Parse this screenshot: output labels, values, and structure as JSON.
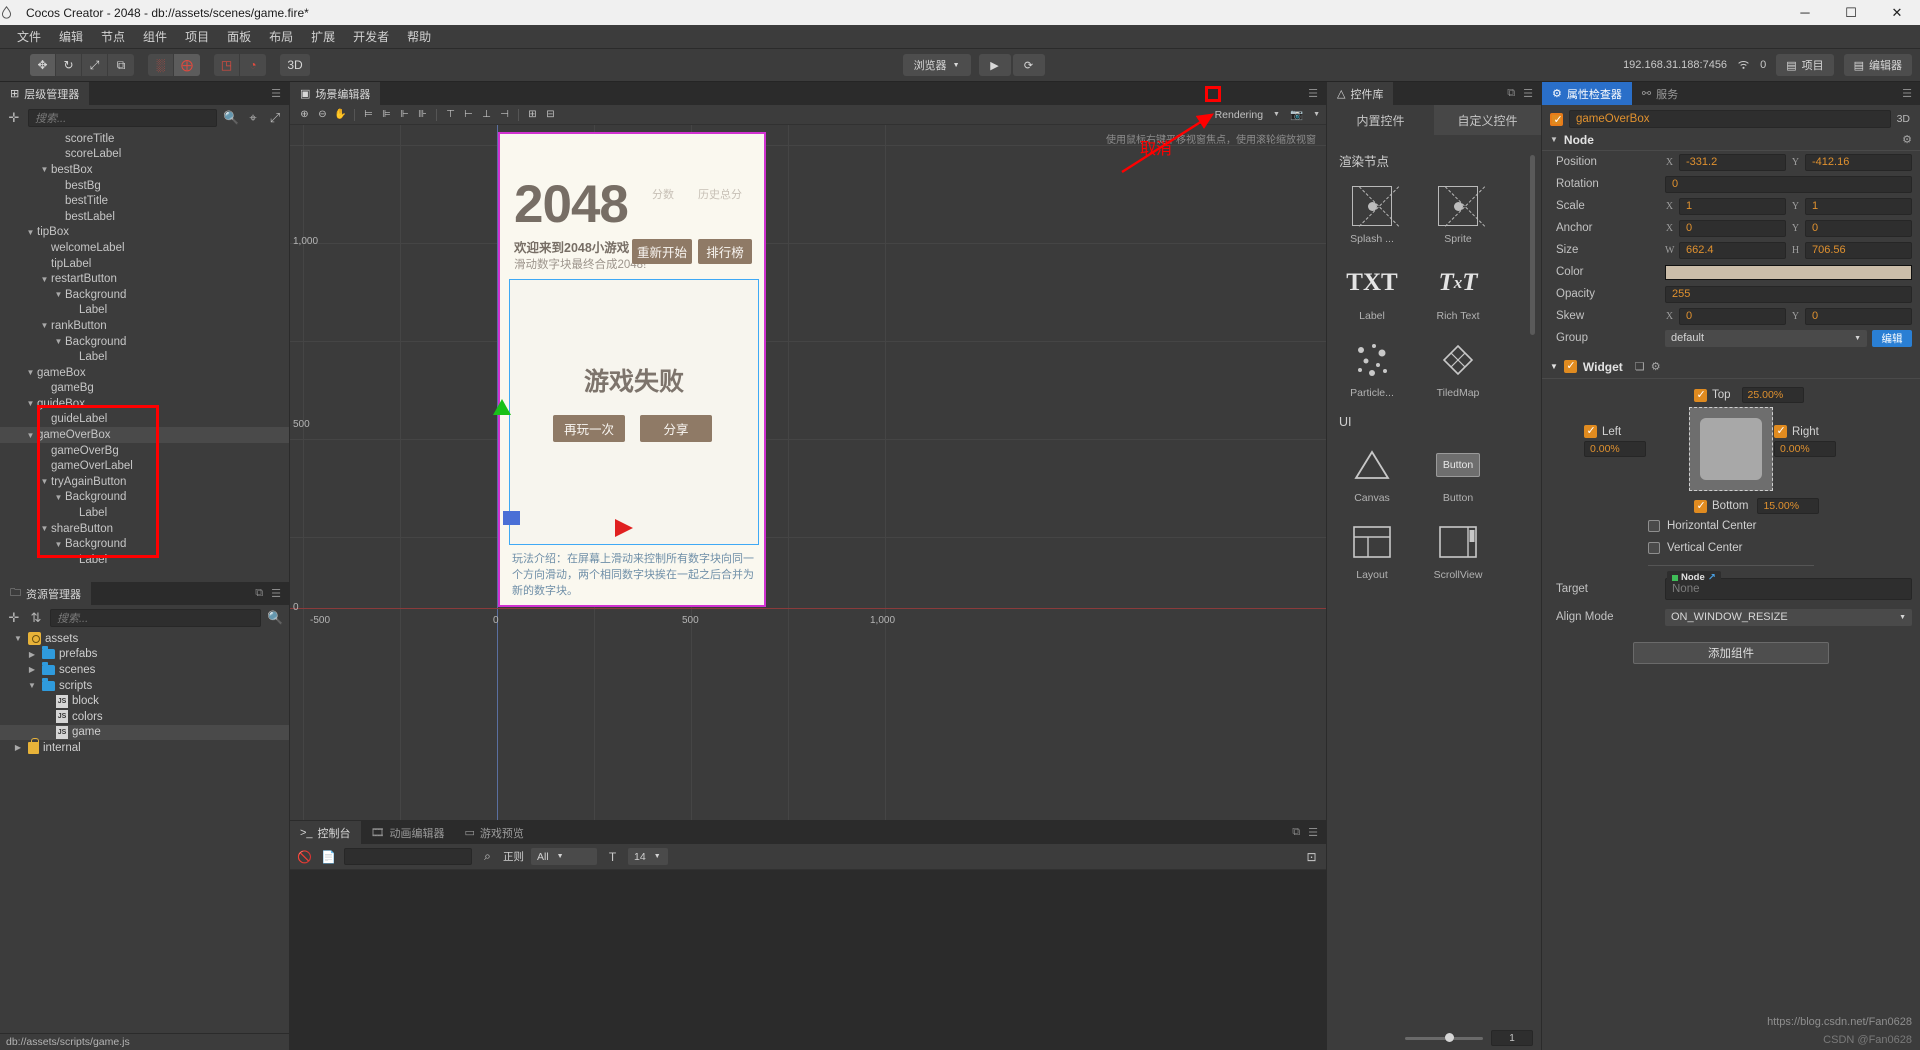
{
  "window": {
    "title": "Cocos Creator - 2048 - db://assets/scenes/game.fire*",
    "logo_icon": "cocos-logo-icon",
    "minimize_label": "─",
    "maximize_label": "☐",
    "close_label": "✕"
  },
  "menu": {
    "items": [
      "文件",
      "编辑",
      "节点",
      "组件",
      "项目",
      "面板",
      "布局",
      "扩展",
      "开发者",
      "帮助"
    ]
  },
  "toolbar": {
    "transform_tools": [
      {
        "icon": "move-tool-icon",
        "label": "✥"
      },
      {
        "icon": "rotate-tool-icon",
        "label": "↻"
      },
      {
        "icon": "scale-tool-icon",
        "label": "⤢"
      },
      {
        "icon": "rect-tool-icon",
        "label": "⧉"
      }
    ],
    "pivot_tools": [
      {
        "icon": "pivot-center-icon",
        "label": "░"
      },
      {
        "icon": "pivot-pos-icon",
        "label": "⨁"
      }
    ],
    "coord_tools": [
      {
        "icon": "local-coord-icon",
        "label": "◳"
      },
      {
        "icon": "global-coord-icon",
        "label": "◔"
      }
    ],
    "dimension_button": "3D",
    "preview_target": "浏览器",
    "preview_caret": "▼",
    "play_label": "▶",
    "refresh_label": "⟳",
    "device_address": "192.168.31.188:7456",
    "wifi_icon": "wifi-icon",
    "device_count": "0",
    "project_button": "项目",
    "editor_button": "编辑器",
    "project_icon": "folder-icon",
    "editor_icon": "folder-icon"
  },
  "hierarchy": {
    "tab_label": "层级管理器",
    "tab_icon": "hierarchy-icon",
    "menu_icon": "hamburger-icon",
    "add_icon": "plus-icon",
    "search_placeholder": "搜索...",
    "search_icon": "search-icon",
    "filter_icon": "filter-icon",
    "expand_icon": "expand-icon",
    "nodes": [
      {
        "label": "scoreTitle",
        "depth": 3,
        "arrow": "",
        "selected": false
      },
      {
        "label": "scoreLabel",
        "depth": 3,
        "arrow": "",
        "selected": false
      },
      {
        "label": "bestBox",
        "depth": 2,
        "arrow": "▼",
        "selected": false
      },
      {
        "label": "bestBg",
        "depth": 3,
        "arrow": "",
        "selected": false
      },
      {
        "label": "bestTitle",
        "depth": 3,
        "arrow": "",
        "selected": false
      },
      {
        "label": "bestLabel",
        "depth": 3,
        "arrow": "",
        "selected": false
      },
      {
        "label": "tipBox",
        "depth": 1,
        "arrow": "▼",
        "selected": false
      },
      {
        "label": "welcomeLabel",
        "depth": 2,
        "arrow": "",
        "selected": false
      },
      {
        "label": "tipLabel",
        "depth": 2,
        "arrow": "",
        "selected": false
      },
      {
        "label": "restartButton",
        "depth": 2,
        "arrow": "▼",
        "selected": false
      },
      {
        "label": "Background",
        "depth": 3,
        "arrow": "▼",
        "selected": false
      },
      {
        "label": "Label",
        "depth": 4,
        "arrow": "",
        "selected": false
      },
      {
        "label": "rankButton",
        "depth": 2,
        "arrow": "▼",
        "selected": false
      },
      {
        "label": "Background",
        "depth": 3,
        "arrow": "▼",
        "selected": false
      },
      {
        "label": "Label",
        "depth": 4,
        "arrow": "",
        "selected": false
      },
      {
        "label": "gameBox",
        "depth": 1,
        "arrow": "▼",
        "selected": false
      },
      {
        "label": "gameBg",
        "depth": 2,
        "arrow": "",
        "selected": false
      },
      {
        "label": "guideBox",
        "depth": 1,
        "arrow": "▼",
        "selected": false
      },
      {
        "label": "guideLabel",
        "depth": 2,
        "arrow": "",
        "selected": false
      },
      {
        "label": "gameOverBox",
        "depth": 1,
        "arrow": "▼",
        "selected": true
      },
      {
        "label": "gameOverBg",
        "depth": 2,
        "arrow": "",
        "selected": false
      },
      {
        "label": "gameOverLabel",
        "depth": 2,
        "arrow": "",
        "selected": false
      },
      {
        "label": "tryAgainButton",
        "depth": 2,
        "arrow": "▼",
        "selected": false
      },
      {
        "label": "Background",
        "depth": 3,
        "arrow": "▼",
        "selected": false
      },
      {
        "label": "Label",
        "depth": 4,
        "arrow": "",
        "selected": false
      },
      {
        "label": "shareButton",
        "depth": 2,
        "arrow": "▼",
        "selected": false
      },
      {
        "label": "Background",
        "depth": 3,
        "arrow": "▼",
        "selected": false
      },
      {
        "label": "Label",
        "depth": 4,
        "arrow": "",
        "selected": false
      }
    ]
  },
  "assets": {
    "tab_label": "资源管理器",
    "tab_icon": "folder-panel-icon",
    "add_icon": "plus-icon",
    "sort_icon": "sort-icon",
    "search_placeholder": "搜索...",
    "search_icon": "search-icon",
    "menu_icon": "hamburger-icon",
    "items": [
      {
        "label": "assets",
        "depth": 0,
        "arrow": "▼",
        "icon": "assets-icon",
        "selected": false
      },
      {
        "label": "prefabs",
        "depth": 1,
        "arrow": "▶",
        "icon": "folder-icon",
        "selected": false
      },
      {
        "label": "scenes",
        "depth": 1,
        "arrow": "▶",
        "icon": "folder-icon",
        "selected": false
      },
      {
        "label": "scripts",
        "depth": 1,
        "arrow": "▼",
        "icon": "folder-icon",
        "selected": false
      },
      {
        "label": "block",
        "depth": 2,
        "arrow": "",
        "icon": "js-icon",
        "selected": false
      },
      {
        "label": "colors",
        "depth": 2,
        "arrow": "",
        "icon": "js-icon",
        "selected": false
      },
      {
        "label": "game",
        "depth": 2,
        "arrow": "",
        "icon": "js-icon",
        "selected": true
      },
      {
        "label": "internal",
        "depth": 0,
        "arrow": "▶",
        "icon": "lock-icon",
        "selected": false
      }
    ],
    "statusbar": {
      "path": "db://assets/scripts/game.js",
      "icons": [
        "unlock-icon",
        "sort-icon",
        "refresh-icon"
      ]
    }
  },
  "scene": {
    "tab_label": "场景编辑器",
    "tab_icon": "scene-icon",
    "menu_icon": "hamburger-icon",
    "dock_icon": "dock-icon",
    "toolbar_icons": [
      "zoom-in-icon",
      "zoom-out-icon",
      "hand-icon",
      "separator",
      "align-left-icon",
      "align-center-h-icon",
      "align-right-icon",
      "separator",
      "align-top-icon",
      "align-center-v-icon",
      "align-bottom-icon",
      "separator",
      "distribute-h-icon",
      "distribute-v-icon"
    ],
    "rendering_label": "Rendering",
    "rendering_caret": "▼",
    "camera_icon": "camera-icon",
    "camera_caret": "▼",
    "hint": "使用鼠标右键平移视窗焦点，使用滚轮缩放视窗",
    "ruler_x": [
      "-500",
      "0",
      "500",
      "1,000"
    ],
    "ruler_y": [
      "1,000",
      "500",
      "0"
    ],
    "gizmos": {
      "green_triangle": "move-up-handle",
      "red_triangle": "move-right-handle",
      "blue_square": "move-xy-handle"
    }
  },
  "game_preview": {
    "title": "2048",
    "score_title": "分数",
    "best_title": "历史总分",
    "welcome": "欢迎来到2048小游戏",
    "tip": "滑动数字块最终合成2048!",
    "restart_button": "重新开始",
    "rank_button": "排行榜",
    "game_over": "游戏失败",
    "try_again_button": "再玩一次",
    "share_button": "分享",
    "guide": "玩法介绍：在屏幕上滑动来控制所有数字块向同一个方向滑动，两个相同数字块挨在一起之后合并为新的数字块。"
  },
  "widget_library": {
    "tab_label": "控件库",
    "tab_icon": "triangle-icon",
    "dock_icon": "dock-icon",
    "menu_icon": "hamburger-icon",
    "tabs": [
      {
        "label": "内置控件",
        "active": true
      },
      {
        "label": "自定义控件",
        "active": false
      }
    ],
    "sections": [
      {
        "title": "渲染节点",
        "items": [
          {
            "label": "Splash ...",
            "icon": "sprite-splash-icon"
          },
          {
            "label": "Sprite",
            "icon": "sprite-icon"
          },
          {
            "label": "Label",
            "icon": "txt-icon"
          },
          {
            "label": "Rich Text",
            "icon": "rich-text-icon"
          },
          {
            "label": "Particle...",
            "icon": "particle-icon"
          },
          {
            "label": "TiledMap",
            "icon": "tiledmap-icon"
          }
        ]
      },
      {
        "title": "UI",
        "items": [
          {
            "label": "Canvas",
            "icon": "canvas-icon"
          },
          {
            "label": "Button",
            "icon": "button-icon"
          },
          {
            "label": "Layout",
            "icon": "layout-icon"
          },
          {
            "label": "ScrollView",
            "icon": "scrollview-icon"
          }
        ]
      }
    ],
    "zoom_value": "1"
  },
  "inspector": {
    "tab_label": "属性检查器",
    "tab_icon": "gear-icon",
    "service_tab_label": "服务",
    "service_tab_icon": "link-icon",
    "menu_icon": "hamburger-icon",
    "node_enabled": true,
    "node_name": "gameOverBox",
    "dimension_badge": "3D",
    "node_section": {
      "title": "Node",
      "arrow": "▼",
      "gear_icon": "gear-icon",
      "properties": [
        {
          "label": "Position",
          "type": "xy",
          "x_label": "X",
          "x": "-331.2",
          "y_label": "Y",
          "y": "-412.16"
        },
        {
          "label": "Rotation",
          "type": "single",
          "value": "0"
        },
        {
          "label": "Scale",
          "type": "xy",
          "x_label": "X",
          "x": "1",
          "y_label": "Y",
          "y": "1"
        },
        {
          "label": "Anchor",
          "type": "xy",
          "x_label": "X",
          "x": "0",
          "y_label": "Y",
          "y": "0"
        },
        {
          "label": "Size",
          "type": "xy",
          "x_label": "W",
          "x": "662.4",
          "y_label": "H",
          "y": "706.56"
        },
        {
          "label": "Color",
          "type": "color",
          "value": "#cbbda9"
        },
        {
          "label": "Opacity",
          "type": "single",
          "value": "255"
        },
        {
          "label": "Skew",
          "type": "xy",
          "x_label": "X",
          "x": "0",
          "y_label": "Y",
          "y": "0"
        },
        {
          "label": "Group",
          "type": "select",
          "value": "default",
          "caret": "▼",
          "button": "编辑"
        }
      ]
    },
    "widget_section": {
      "title": "Widget",
      "arrow": "▼",
      "enabled": true,
      "copy_icon": "copy-icon",
      "gear_icon": "gear-icon",
      "top": {
        "label": "Top",
        "checked": true,
        "value": "25.00%"
      },
      "left": {
        "label": "Left",
        "checked": true,
        "value": "0.00%"
      },
      "right": {
        "label": "Right",
        "checked": true,
        "value": "0.00%"
      },
      "bottom": {
        "label": "Bottom",
        "checked": true,
        "value": "15.00%"
      },
      "horizontal_center": {
        "label": "Horizontal Center",
        "checked": false
      },
      "vertical_center": {
        "label": "Vertical Center",
        "checked": false
      },
      "target": {
        "label": "Target",
        "tag": "Node",
        "link_icon": "external-link-icon",
        "value": "None"
      },
      "align_mode": {
        "label": "Align Mode",
        "value": "ON_WINDOW_RESIZE",
        "caret": "▼"
      }
    },
    "add_component_button": "添加组件"
  },
  "console": {
    "tab_label": "控制台",
    "tab_icon": "console-icon",
    "animation_tab_label": "动画编辑器",
    "animation_tab_icon": "film-icon",
    "preview_tab_label": "游戏预览",
    "preview_tab_icon": "preview-icon",
    "dock_icon": "dock-icon",
    "menu_icon": "hamburger-icon",
    "clear_icon": "no-entry-icon",
    "file_icon": "file-icon",
    "search_value": "",
    "normal_label": "正则",
    "normal_icon": "regex-icon",
    "filter_value": "All",
    "filter_caret": "▼",
    "font_icon": "font-size-icon",
    "font_size": "14",
    "font_caret": "▼",
    "expand_icon": "expand-icon"
  },
  "annotations": {
    "cancel_text": "取消",
    "arrow_icon": "red-arrow-icon",
    "hierarchy_highlight": "red-rectangle",
    "checkbox_highlight": "red-rectangle"
  },
  "watermarks": {
    "blog": "https://blog.csdn.net/Fan0628",
    "footer": "CSDN @Fan0628"
  }
}
